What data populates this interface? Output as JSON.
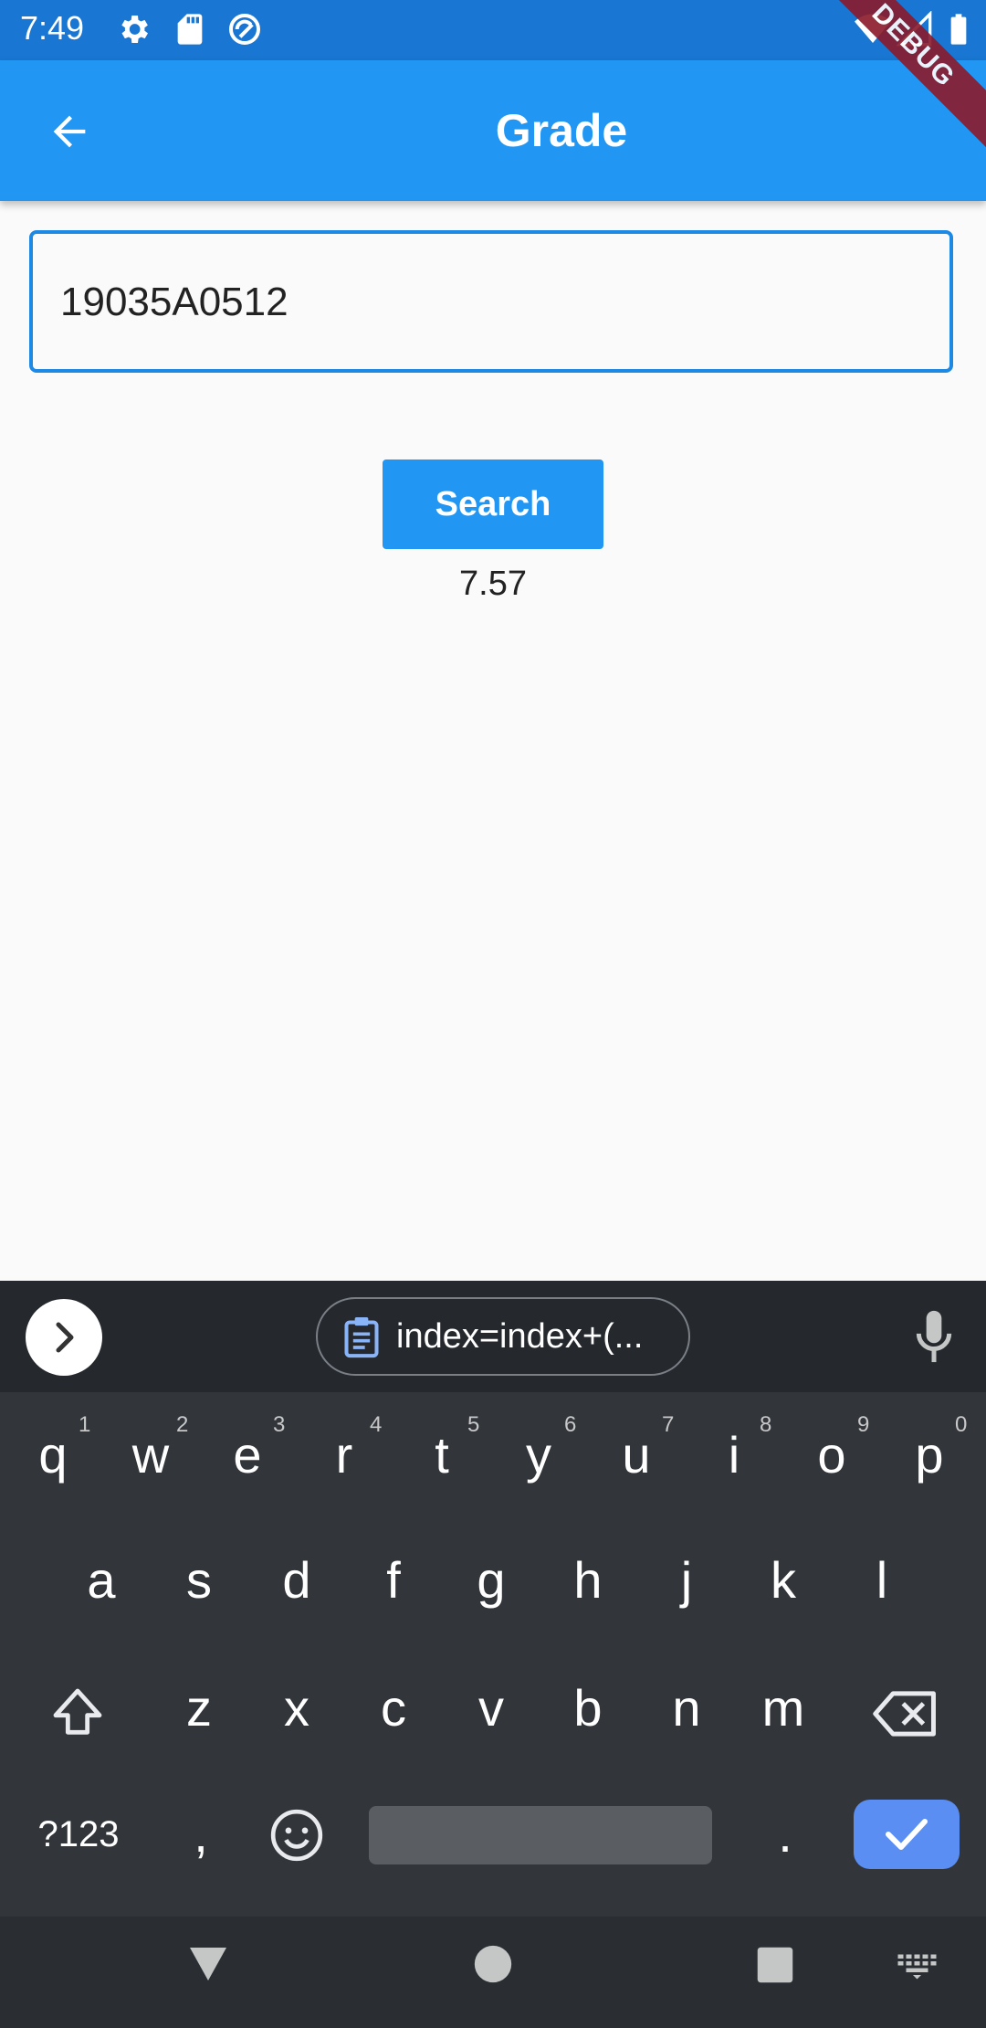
{
  "status_bar": {
    "time": "7:49",
    "icons": [
      "gear-icon",
      "sd-card-icon",
      "sync-icon",
      "wifi-icon",
      "signal-icon",
      "battery-icon"
    ]
  },
  "app_bar": {
    "title": "Grade",
    "debug_banner": "DEBUG",
    "color": "#2196f3"
  },
  "form": {
    "roll_number_value": "19035A0512",
    "search_label": "Search",
    "result": "7.57"
  },
  "keyboard": {
    "clipboard_suggestion": "index=index+(...",
    "row1": [
      {
        "key": "q",
        "hint": "1"
      },
      {
        "key": "w",
        "hint": "2"
      },
      {
        "key": "e",
        "hint": "3"
      },
      {
        "key": "r",
        "hint": "4"
      },
      {
        "key": "t",
        "hint": "5"
      },
      {
        "key": "y",
        "hint": "6"
      },
      {
        "key": "u",
        "hint": "7"
      },
      {
        "key": "i",
        "hint": "8"
      },
      {
        "key": "o",
        "hint": "9"
      },
      {
        "key": "p",
        "hint": "0"
      }
    ],
    "row2": [
      "a",
      "s",
      "d",
      "f",
      "g",
      "h",
      "j",
      "k",
      "l"
    ],
    "row3": [
      "z",
      "x",
      "c",
      "v",
      "b",
      "n",
      "m"
    ],
    "symbols_label": "?123",
    "comma": ",",
    "period": "."
  }
}
